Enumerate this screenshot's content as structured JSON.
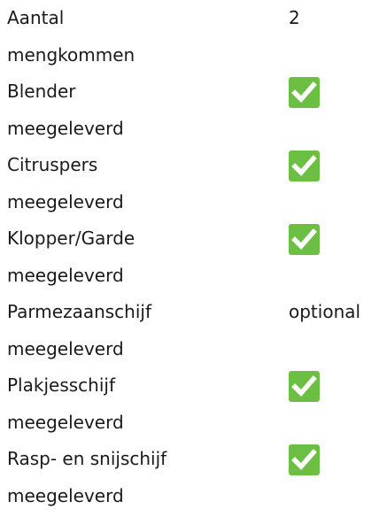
{
  "colors": {
    "check_background": "#6cbf43",
    "check_mark": "#ffffff",
    "text": "#1a1a1a"
  },
  "specs": [
    {
      "label_line1": "Aantal",
      "label_line2": "mengkommen",
      "value": "2",
      "value_type": "text"
    },
    {
      "label_line1": "Blender",
      "label_line2": "meegeleverd",
      "value": "yes",
      "value_type": "check-icon"
    },
    {
      "label_line1": "Citruspers",
      "label_line2": "meegeleverd",
      "value": "yes",
      "value_type": "check-icon"
    },
    {
      "label_line1": "Klopper/Garde",
      "label_line2": "meegeleverd",
      "value": "yes",
      "value_type": "check-icon"
    },
    {
      "label_line1": "Parmezaanschijf",
      "label_line2": "meegeleverd",
      "value": "optional",
      "value_type": "text"
    },
    {
      "label_line1": "Plakjesschijf",
      "label_line2": "meegeleverd",
      "value": "yes",
      "value_type": "check-icon"
    },
    {
      "label_line1": "Rasp- en snijschijf",
      "label_line2": "meegeleverd",
      "value": "yes",
      "value_type": "check-icon"
    }
  ]
}
